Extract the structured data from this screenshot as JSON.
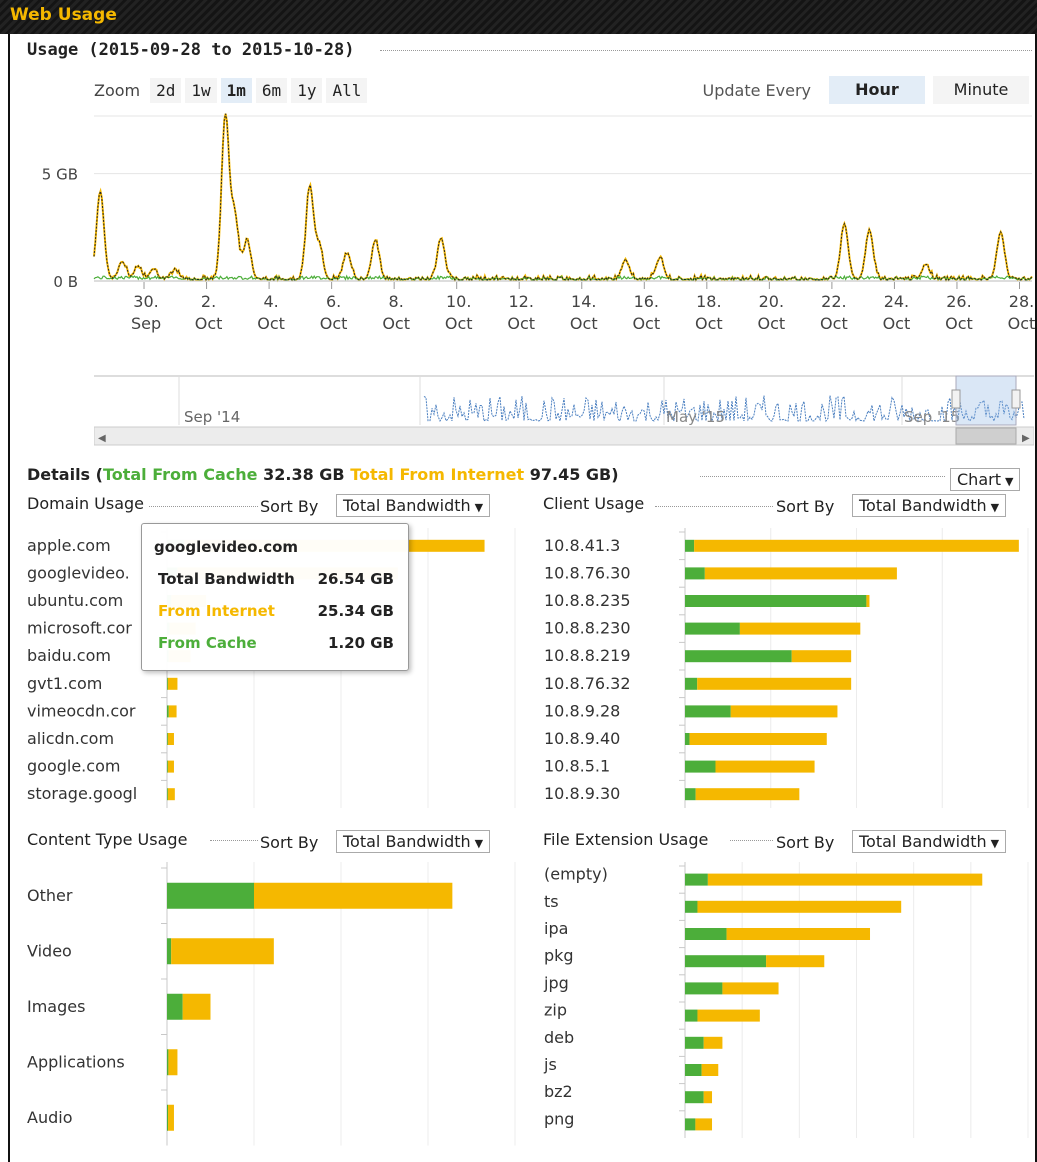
{
  "app": {
    "title": "Web Usage"
  },
  "usage": {
    "title": "Usage (2015-09-28 to 2015-10-28)",
    "zoom_label": "Zoom",
    "zoom_options": [
      "2d",
      "1w",
      "1m",
      "6m",
      "1y",
      "All"
    ],
    "zoom_selected": "1m",
    "update_label": "Update Every",
    "update_options": [
      "Hour",
      "Minute"
    ],
    "update_selected": "Hour"
  },
  "chart_data": [
    {
      "type": "line",
      "y_ticks": [
        "5 GB",
        "0 B"
      ],
      "x_ticks": [
        [
          "30.",
          "Sep"
        ],
        [
          "2.",
          "Oct"
        ],
        [
          "4.",
          "Oct"
        ],
        [
          "6.",
          "Oct"
        ],
        [
          "8.",
          "Oct"
        ],
        [
          "10.",
          "Oct"
        ],
        [
          "12.",
          "Oct"
        ],
        [
          "14.",
          "Oct"
        ],
        [
          "16.",
          "Oct"
        ],
        [
          "18.",
          "Oct"
        ],
        [
          "20.",
          "Oct"
        ],
        [
          "22.",
          "Oct"
        ],
        [
          "24.",
          "Oct"
        ],
        [
          "26.",
          "Oct"
        ],
        [
          "28.",
          "Oct"
        ]
      ],
      "ylim_gb": [
        0,
        7.5
      ],
      "series_colors": {
        "total": "#222222",
        "internet": "#f5b800",
        "cache": "#4cae3a"
      },
      "spikes_gb": [
        {
          "day": 28.6,
          "total": 4.1
        },
        {
          "day": 29.3,
          "total": 0.8
        },
        {
          "day": 29.8,
          "total": 0.6
        },
        {
          "day": 30.3,
          "total": 0.5
        },
        {
          "day": 31.0,
          "total": 0.4
        },
        {
          "day": 32.6,
          "total": 7.6
        },
        {
          "day": 32.9,
          "total": 3.0
        },
        {
          "day": 33.3,
          "total": 1.8
        },
        {
          "day": 35.3,
          "total": 4.3
        },
        {
          "day": 35.6,
          "total": 1.5
        },
        {
          "day": 36.5,
          "total": 1.2
        },
        {
          "day": 37.4,
          "total": 1.8
        },
        {
          "day": 39.5,
          "total": 1.9
        },
        {
          "day": 45.4,
          "total": 0.9
        },
        {
          "day": 46.5,
          "total": 1.0
        },
        {
          "day": 52.4,
          "total": 2.6
        },
        {
          "day": 53.2,
          "total": 2.3
        },
        {
          "day": 55.0,
          "total": 0.7
        },
        {
          "day": 57.4,
          "total": 2.2
        }
      ],
      "navigator": {
        "label_left": "Sep '14",
        "label_mid": "May '15",
        "label_right": "Sep '15"
      }
    },
    {
      "type": "bar",
      "name": "Domain Usage",
      "categories": [
        "apple.com",
        "googlevideo.",
        "ubuntu.com",
        "microsoft.cor",
        "baidu.com",
        "gvt1.com",
        "vimeocdn.cor",
        "alicdn.com",
        "google.com",
        "storage.googl"
      ],
      "cache_gb": [
        2.0,
        1.2,
        0.5,
        0.3,
        0.2,
        0.1,
        0.2,
        0.1,
        0.1,
        0.1
      ],
      "internet_gb": [
        34.5,
        25.34,
        4.0,
        3.0,
        2.5,
        1.1,
        0.9,
        0.7,
        0.7,
        0.8
      ],
      "xmax_gb": 40
    },
    {
      "type": "bar",
      "name": "Client Usage",
      "categories": [
        "10.8.41.3",
        "10.8.76.30",
        "10.8.8.235",
        "10.8.8.230",
        "10.8.8.219",
        "10.8.76.32",
        "10.8.9.28",
        "10.8.9.40",
        "10.8.5.1",
        "10.8.9.30"
      ],
      "cache_gb": [
        0.6,
        1.3,
        11.9,
        3.6,
        7.0,
        0.8,
        3.0,
        0.3,
        2.0,
        0.7
      ],
      "internet_gb": [
        21.3,
        12.6,
        0.2,
        7.9,
        3.9,
        10.1,
        7.0,
        9.0,
        6.5,
        6.8
      ],
      "xmax_gb": 22.5
    },
    {
      "type": "bar",
      "name": "Content Type Usage",
      "categories": [
        "Other",
        "Video",
        "Images",
        "Applications",
        "Audio"
      ],
      "cache_gb": [
        25.0,
        1.2,
        4.5,
        0.4,
        0.3
      ],
      "internet_gb": [
        57.0,
        29.5,
        8.0,
        2.6,
        1.7
      ],
      "xmax_gb": 100
    },
    {
      "type": "bar",
      "name": "File Extension Usage",
      "categories": [
        "(empty)",
        "ts",
        "ipa",
        "pkg",
        "jpg",
        "zip",
        "deb",
        "js",
        "bz2",
        "png"
      ],
      "cache_gb": [
        1.1,
        0.6,
        2.0,
        3.9,
        1.8,
        0.6,
        0.9,
        0.8,
        0.9,
        0.5
      ],
      "internet_gb": [
        13.2,
        9.8,
        6.9,
        2.8,
        2.7,
        3.0,
        0.9,
        0.8,
        0.4,
        0.8
      ],
      "xmax_gb": 16.5
    }
  ],
  "details": {
    "label": "Details (",
    "cache_label": "Total From Cache",
    "cache_value": "32.38 GB",
    "internet_label": "Total From Internet",
    "internet_value": "97.45 GB)",
    "view_select": "Chart"
  },
  "panels": {
    "domain": {
      "title": "Domain Usage",
      "sort_label": "Sort By",
      "sort_value": "Total Bandwidth"
    },
    "client": {
      "title": "Client Usage",
      "sort_label": "Sort By",
      "sort_value": "Total Bandwidth"
    },
    "content": {
      "title": "Content Type Usage",
      "sort_label": "Sort By",
      "sort_value": "Total Bandwidth"
    },
    "fileext": {
      "title": "File Extension Usage",
      "sort_label": "Sort By",
      "sort_value": "Total Bandwidth"
    }
  },
  "tooltip": {
    "title": "googlevideo.com",
    "total_label": "Total Bandwidth",
    "total_value": "26.54 GB",
    "internet_label": "From Internet",
    "internet_value": "25.34 GB",
    "cache_label": "From Cache",
    "cache_value": "1.20 GB"
  },
  "colors": {
    "cache": "#4cae3a",
    "internet": "#f5b800",
    "accent": "#f5b800"
  }
}
